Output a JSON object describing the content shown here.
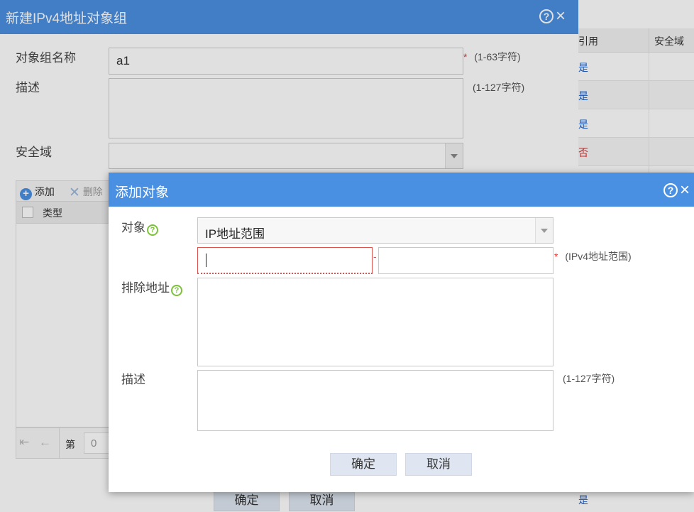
{
  "background": {
    "columns": [
      "引用",
      "安全域"
    ],
    "rows": [
      "是",
      "是",
      "是",
      "否"
    ],
    "bottom_value": "是"
  },
  "outer_dialog": {
    "title": "新建IPv4地址对象组",
    "help_icon": "?",
    "close_icon": "×",
    "name_label": "对象组名称",
    "name_value": "a1",
    "name_required": "*",
    "name_hint": "(1-63字符)",
    "desc_label": "描述",
    "desc_hint": "(1-127字符)",
    "zone_label": "安全域",
    "zone_value": "",
    "toolbar": {
      "add_label": "添加",
      "delete_label": "删除"
    },
    "grid": {
      "type_col": "类型"
    },
    "pager": {
      "page_label": "第",
      "page_value": "0"
    },
    "ok_label": "确定",
    "cancel_label": "取消"
  },
  "inner_dialog": {
    "title": "添加对象",
    "help_icon": "?",
    "close_icon": "×",
    "object_label": "对象",
    "object_value": "IP地址范围",
    "range_start": "",
    "range_separator": "-",
    "range_end": "",
    "range_required": "*",
    "range_hint": "(IPv4地址范围)",
    "exclude_label": "排除地址",
    "desc_label": "描述",
    "desc_hint": "(1-127字符)",
    "question_icon": "?",
    "ok_label": "确定",
    "cancel_label": "取消"
  },
  "colors": {
    "title_bar": "#4a90e2",
    "button_bg": "#dfe6f1",
    "error_border": "#d9534f",
    "help_green": "#7cc13a",
    "required_red": "#e33333"
  }
}
